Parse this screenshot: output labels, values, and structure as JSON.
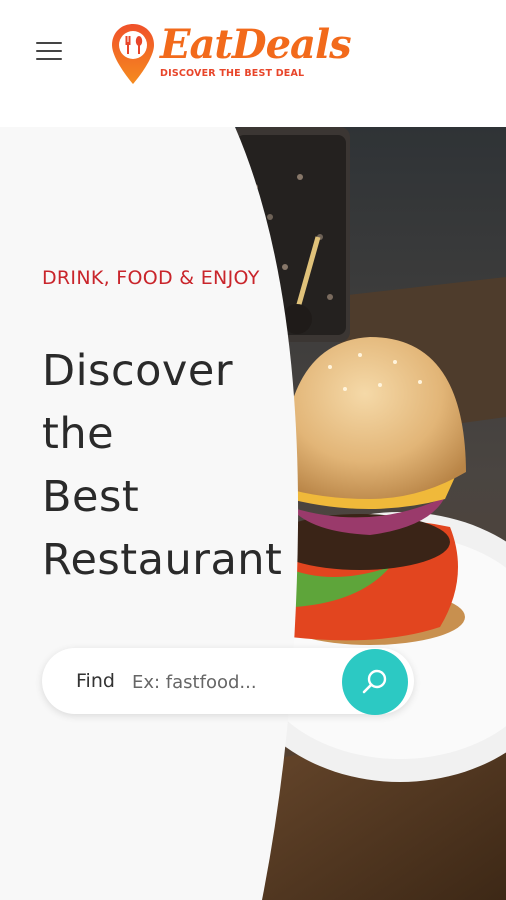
{
  "header": {
    "brand": "EatDeals",
    "tagline": "DISCOVER THE BEST DEAL",
    "menu_icon": "hamburger-icon",
    "brand_colors": {
      "primary": "#f26a1b",
      "accent": "#e8452a"
    }
  },
  "hero": {
    "eyebrow": "DRINK, FOOD & ENJOY",
    "headline": "Discover\nthe\nBest\nRestaurant",
    "eyebrow_color": "#c9252b"
  },
  "search": {
    "label": "Find",
    "placeholder": "Ex: fastfood...",
    "button_icon": "search-icon",
    "button_color": "#2cc9c3"
  }
}
